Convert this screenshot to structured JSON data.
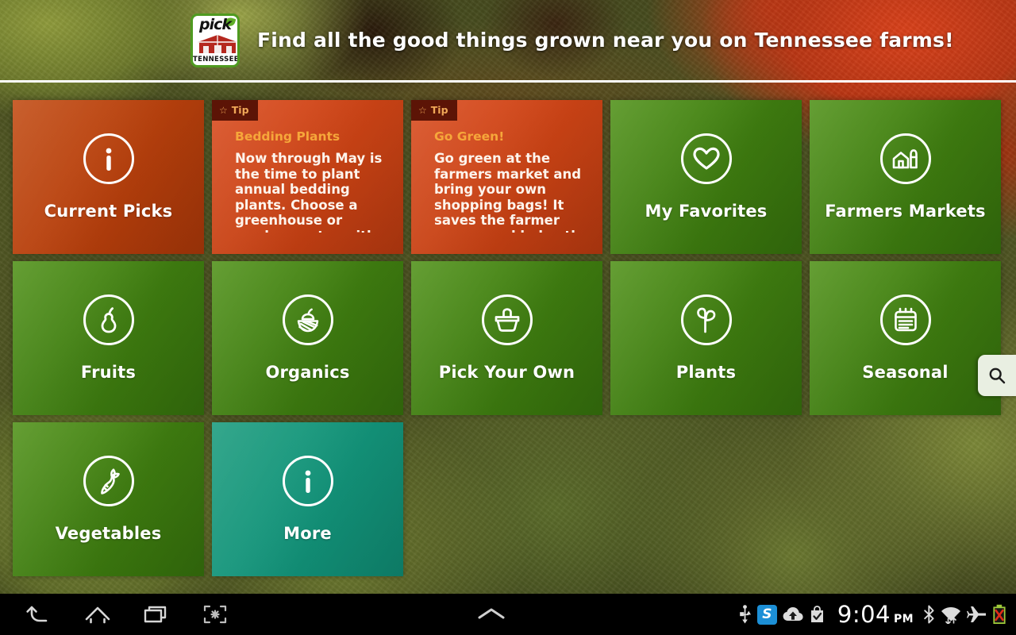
{
  "header": {
    "logo": {
      "word_top": "pick",
      "word_bottom": "TENNESSEE",
      "icon": "pick-tennessee-barn-logo"
    },
    "headline": "Find all the good things grown near you on Tennessee farms!"
  },
  "colors": {
    "tile_green": "#44850f",
    "tile_orange": "#b8400c",
    "tile_teal": "#139a7b",
    "tip_orange": "#cd4415",
    "tip_badge_bg": "#5c1406",
    "tip_badge_text": "#f0a858",
    "tip_title": "#f6a73a",
    "logo_border_green": "#4f9a20",
    "logo_barn_red": "#b5281f"
  },
  "tiles": [
    {
      "id": "current-picks",
      "type": "nav",
      "label": "Current Picks",
      "icon": "info-icon",
      "color": "orange"
    },
    {
      "id": "tip-bedding-plants",
      "type": "tip",
      "badge": "Tip",
      "badge_icon": "star-icon",
      "title": "Bedding Plants",
      "body": "Now through May is the time to plant annual bedding plants. Choose a greenhouse or garden center with locally"
    },
    {
      "id": "tip-go-green",
      "type": "tip",
      "badge": "Tip",
      "badge_icon": "star-icon",
      "title": "Go Green!",
      "body": "Go green at the farmers market and bring your own shopping bags!  It saves the farmer money and helps the"
    },
    {
      "id": "my-favorites",
      "type": "nav",
      "label": "My Favorites",
      "icon": "heart-icon",
      "color": "green"
    },
    {
      "id": "farmers-markets",
      "type": "nav",
      "label": "Farmers Markets",
      "icon": "barn-silo-icon",
      "color": "green"
    },
    {
      "id": "fruits",
      "type": "nav",
      "label": "Fruits",
      "icon": "pear-icon",
      "color": "green"
    },
    {
      "id": "organics",
      "type": "nav",
      "label": "Organics",
      "icon": "organic-field-icon",
      "color": "green"
    },
    {
      "id": "pick-your-own",
      "type": "nav",
      "label": "Pick Your Own",
      "icon": "basket-icon",
      "color": "green"
    },
    {
      "id": "plants",
      "type": "nav",
      "label": "Plants",
      "icon": "sprout-icon",
      "color": "green"
    },
    {
      "id": "seasonal",
      "type": "nav",
      "label": "Seasonal",
      "icon": "calendar-icon",
      "color": "green"
    },
    {
      "id": "vegetables",
      "type": "nav",
      "label": "Vegetables",
      "icon": "carrot-icon",
      "color": "green"
    },
    {
      "id": "more",
      "type": "nav",
      "label": "More",
      "icon": "info-icon",
      "color": "teal"
    }
  ],
  "search": {
    "icon": "search-icon",
    "label": "Search"
  },
  "system_bar": {
    "nav": [
      {
        "id": "back",
        "icon": "back-arrow-icon"
      },
      {
        "id": "home",
        "icon": "home-icon"
      },
      {
        "id": "recents",
        "icon": "recent-apps-icon"
      },
      {
        "id": "screenshot",
        "icon": "screenshot-icon"
      }
    ],
    "center": {
      "icon": "chevron-up-icon"
    },
    "status_icons_left": [
      {
        "id": "usb",
        "icon": "usb-icon"
      },
      {
        "id": "skype",
        "icon": "skype-icon",
        "glyph": "S"
      },
      {
        "id": "cloud-upload",
        "icon": "cloud-upload-icon"
      },
      {
        "id": "app-installed",
        "icon": "bag-check-icon"
      }
    ],
    "clock": {
      "time": "9:04",
      "ampm": "PM"
    },
    "status_icons_right": [
      {
        "id": "bluetooth",
        "icon": "bluetooth-icon"
      },
      {
        "id": "wifi",
        "icon": "wifi-icon"
      },
      {
        "id": "airplane",
        "icon": "airplane-mode-icon"
      },
      {
        "id": "battery",
        "icon": "battery-error-icon"
      }
    ]
  }
}
